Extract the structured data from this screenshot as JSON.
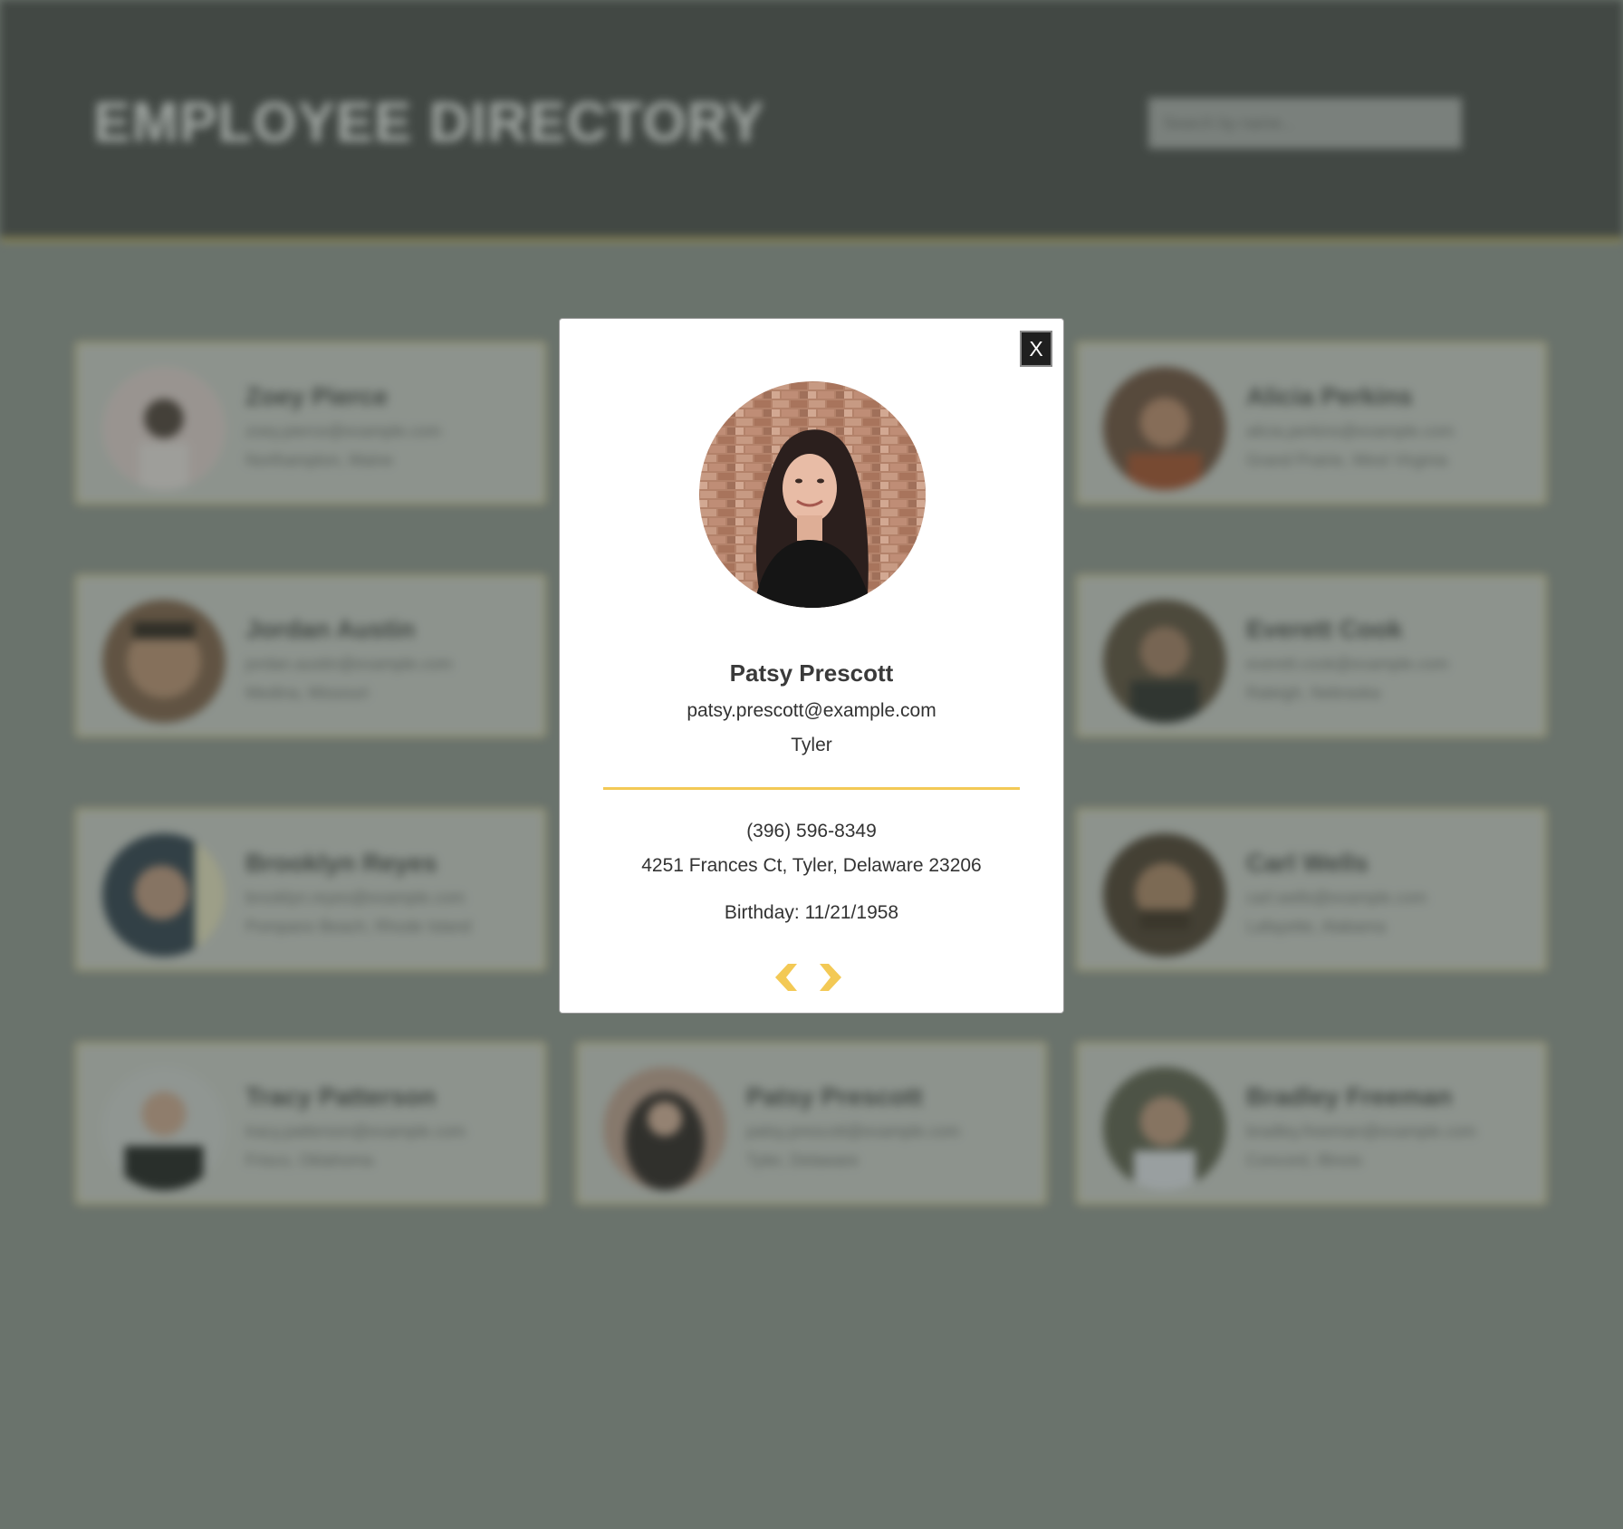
{
  "header": {
    "title": "EMPLOYEE DIRECTORY",
    "search_placeholder": "Search by name..."
  },
  "cards": [
    {
      "name": "Zoey Pierce",
      "email": "zoey.pierce@example.com",
      "location": "Northampton, Maine",
      "avatar_color": "#e8d6d6"
    },
    {
      "name": "Alicia Perkins",
      "email": "alicia.perkins@example.com",
      "location": "Grand Prairie, West Virginia",
      "avatar_color": "#7a5a4a"
    },
    {
      "name": "Jordan Austin",
      "email": "jordan.austin@example.com",
      "location": "Medina, Missouri",
      "avatar_color": "#8a6a55"
    },
    {
      "name": "Everett Cook",
      "email": "everett.cook@example.com",
      "location": "Raleigh, Nebraska",
      "avatar_color": "#6a5a4a"
    },
    {
      "name": "Brooklyn Reyes",
      "email": "brooklyn.reyes@example.com",
      "location": "Pompano Beach, Rhode Island",
      "avatar_color": "#3d4a5a"
    },
    {
      "name": "Carl Wells",
      "email": "carl.wells@example.com",
      "location": "Lafayette, Alabama",
      "avatar_color": "#5a4a3d"
    },
    {
      "name": "Tracy Patterson",
      "email": "tracy.patterson@example.com",
      "location": "Frisco, Oklahoma",
      "avatar_color": "#d9d9d9"
    },
    {
      "name": "Patsy Prescott",
      "email": "patsy.prescott@example.com",
      "location": "Tyler, Delaware",
      "avatar_color": "#3a3030"
    },
    {
      "name": "Bradley Freeman",
      "email": "bradley.freeman@example.com",
      "location": "Concord, Illinois",
      "avatar_color": "#6a6a5a"
    }
  ],
  "modal": {
    "close_label": "X",
    "name": "Patsy Prescott",
    "email": "patsy.prescott@example.com",
    "city": "Tyler",
    "phone": "(396) 596-8349",
    "address": "4251 Frances Ct, Tyler, Delaware 23206",
    "birthday": "Birthday: 11/21/1958"
  },
  "colors": {
    "accent": "#f3c955",
    "header_bg": "#575757",
    "overlay": "#7d827d"
  },
  "icons": {
    "prev": "chevron-left-icon",
    "next": "chevron-right-icon"
  }
}
